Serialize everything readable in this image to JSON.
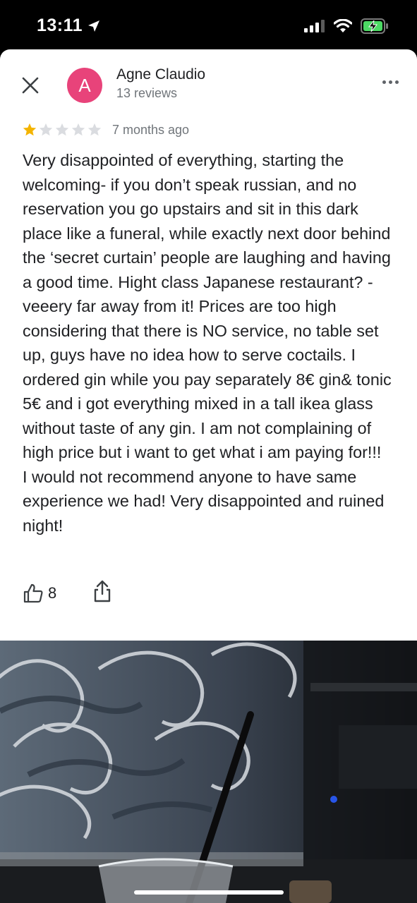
{
  "status_bar": {
    "time": "13:11",
    "icons": [
      "location-arrow-icon",
      "cellular-signal-icon",
      "wifi-icon",
      "battery-charging-icon"
    ]
  },
  "review": {
    "author": {
      "name": "Agne Claudio",
      "initial": "A",
      "reviews_count": "13 reviews",
      "avatar_color": "#e8437a"
    },
    "rating": 1,
    "rating_max": 5,
    "date": "7 months ago",
    "text": "Very disappointed of everything, starting the welcoming- if you don’t speak russian, and no reservation you go upstairs and sit in this dark place like a funeral, while exactly next door behind the ‘secret curtain’ people are laughing and having a good time. Hight class Japanese restaurant? - veeery far away from it! Prices are too high considering that there is NO service, no table set up, guys have no idea how to serve coctails. I ordered gin while you pay separately 8€ gin& tonic 5€ and i got everything mixed in a tall ikea glass without taste of any gin. I am not complaining of high price but i want to get what i am paying for!!!\nI would not recommend anyone to have same experience we had! Very disappointed and ruined night!",
    "likes": "8"
  },
  "icons": {
    "close": "close-icon",
    "more": "more-options-icon",
    "like": "thumbs-up-icon",
    "share": "share-icon"
  },
  "colors": {
    "star_filled": "#f4b400",
    "star_empty": "#dadce0",
    "accent_avatar": "#e8437a"
  },
  "photo": {
    "description_icon": "review-photo"
  }
}
